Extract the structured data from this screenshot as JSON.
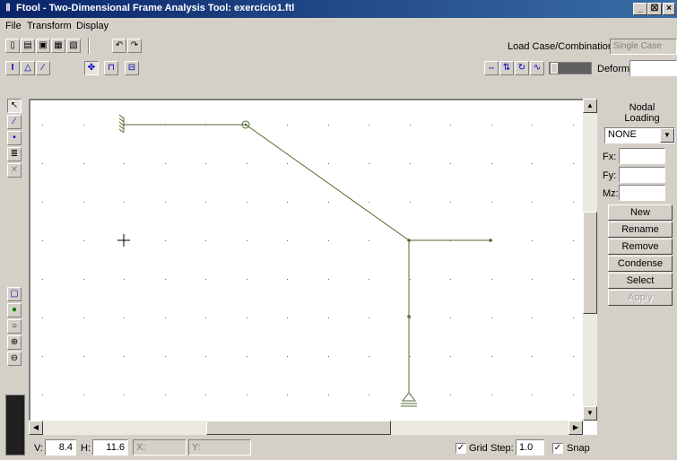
{
  "window": {
    "title": "Ftool - Two-Dimensional Frame Analysis Tool: exercício1.ftl",
    "app_icon": "frame-icon",
    "controls": [
      "_",
      "☒",
      "×"
    ]
  },
  "menu": [
    "File",
    "Transform",
    "Display"
  ],
  "toolbar1": {
    "load_case_label": "Load Case/Combination:",
    "load_case_value": "Single Case"
  },
  "toolbar2": {
    "deform_label": "Deform:",
    "deform_value": ""
  },
  "nodal_panel": {
    "title": "Nodal Loading",
    "select_value": "NONE",
    "fx_label": "Fx:",
    "fy_label": "Fy:",
    "mz_label": "Mz:",
    "fx_value": "",
    "fy_value": "",
    "mz_value": "",
    "buttons": [
      "New",
      "Rename",
      "Remove",
      "Condense",
      "Select",
      "Apply"
    ]
  },
  "status": {
    "v_label": "V:",
    "v_value": "8.4",
    "h_label": "H:",
    "h_value": "11.6",
    "x_label": "X:",
    "x_value": "",
    "y_label": "Y:",
    "y_value": "",
    "grid_label": "Grid",
    "grid_checked": true,
    "step_label": "Step:",
    "step_value": "1.0",
    "snap_label": "Snap",
    "snap_checked": true
  },
  "colors": {
    "titlebar": "#0a246a",
    "member": "#556b2f",
    "canvas": "#ffffff"
  }
}
